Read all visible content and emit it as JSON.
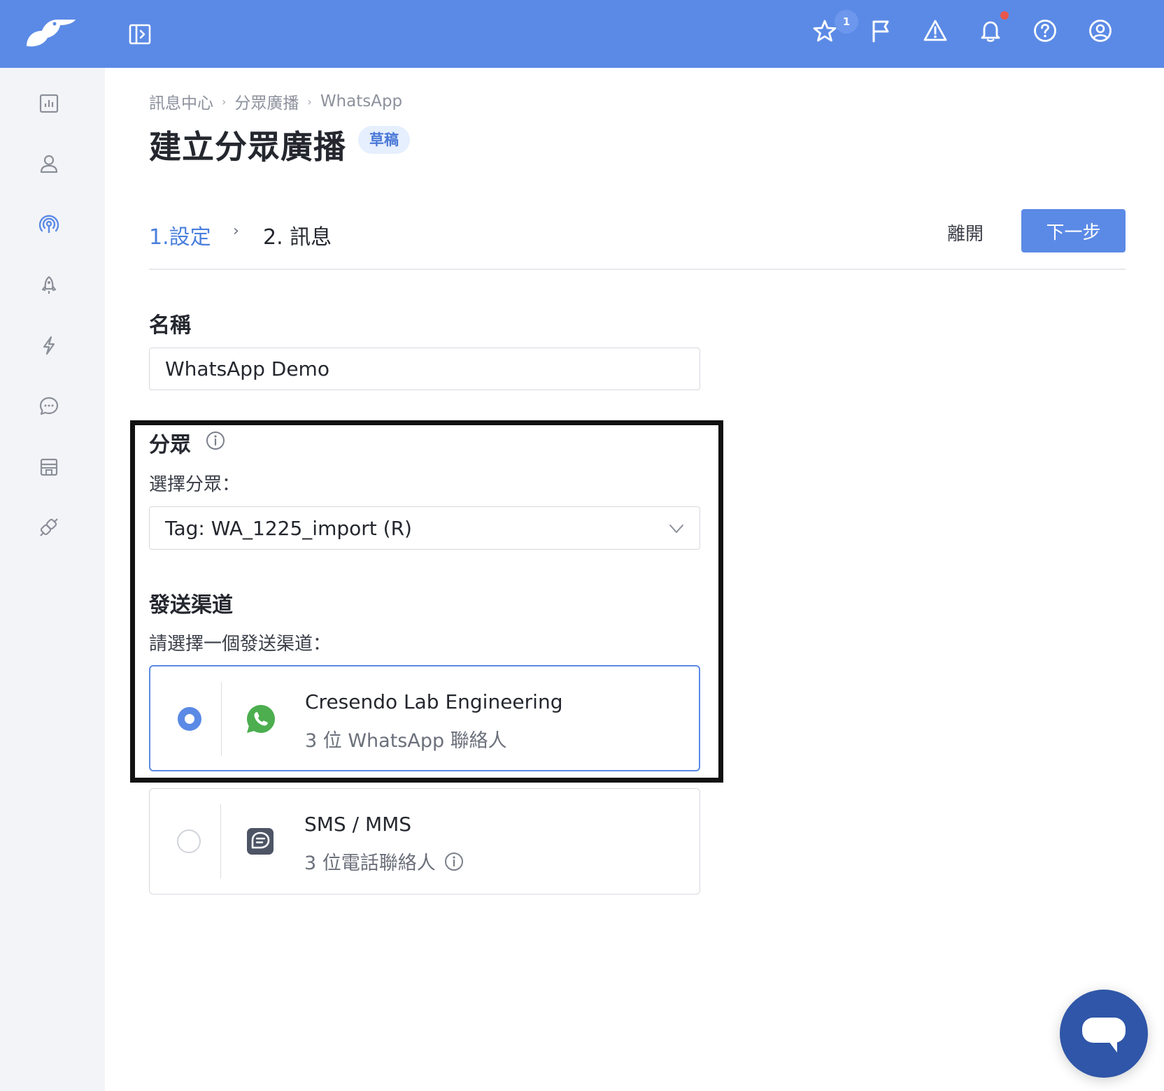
{
  "header": {
    "star_badge_count": "1"
  },
  "breadcrumb": [
    "訊息中心",
    "分眾廣播",
    "WhatsApp"
  ],
  "page": {
    "title": "建立分眾廣播",
    "status_badge": "草稿"
  },
  "steps": [
    {
      "label": "1.設定",
      "active": true
    },
    {
      "label": "2. 訊息",
      "active": false
    }
  ],
  "actions": {
    "leave_label": "離開",
    "next_label": "下一步"
  },
  "form": {
    "name_label": "名稱",
    "name_value": "WhatsApp Demo",
    "segment_label": "分眾",
    "segment_select_label": "選擇分眾：",
    "segment_value": "Tag: WA_1225_import (R)",
    "channel_label": "發送渠道",
    "channel_select_label": "請選擇一個發送渠道："
  },
  "channels": [
    {
      "title": "Cresendo Lab Engineering",
      "subtitle": "3 位 WhatsApp 聯絡人",
      "selected": true,
      "icon": "whatsapp-icon"
    },
    {
      "title": "SMS / MMS",
      "subtitle": "3 位電話聯絡人",
      "selected": false,
      "icon": "sms-icon"
    }
  ],
  "colors": {
    "brand": "#5b8ae6",
    "active_step": "#4a7fdc",
    "whatsapp": "#4cae4f",
    "chat_fab": "#2f56a8",
    "notification_dot": "#e8574b"
  },
  "icons": {
    "sidebar": [
      "chart-icon",
      "user-icon",
      "broadcast-icon",
      "rocket-icon",
      "lightning-icon",
      "chat-bubble-icon",
      "store-icon",
      "plugin-icon"
    ],
    "topbar": [
      "star-icon",
      "flag-icon",
      "warning-icon",
      "bell-icon",
      "help-icon",
      "account-icon"
    ]
  }
}
